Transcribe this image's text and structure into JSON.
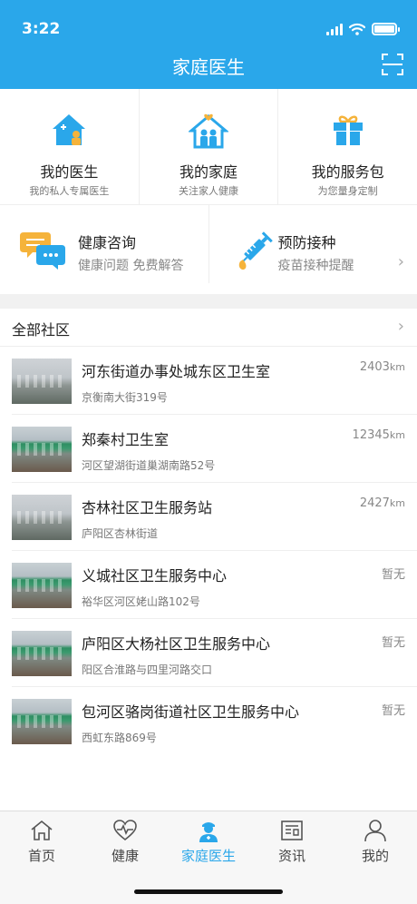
{
  "status_bar": {
    "time": "3:22"
  },
  "header": {
    "title": "家庭医生"
  },
  "features": [
    {
      "title": "我的医生",
      "subtitle": "我的私人专属医生",
      "icon": "doctor-house-icon"
    },
    {
      "title": "我的家庭",
      "subtitle": "关注家人健康",
      "icon": "family-house-icon"
    },
    {
      "title": "我的服务包",
      "subtitle": "为您量身定制",
      "icon": "gift-icon"
    }
  ],
  "services": [
    {
      "title": "健康咨询",
      "subtitle": "健康问题  免费解答",
      "icon": "chat-bubbles-icon"
    },
    {
      "title": "预防接种",
      "subtitle": "疫苗接种提醒",
      "icon": "syringe-icon"
    }
  ],
  "community": {
    "title": "全部社区",
    "items": [
      {
        "name": "河东街道办事处城东区卫生室",
        "address": "京衡南大街319号",
        "distance": "2403",
        "unit": "km",
        "thumb": "gray"
      },
      {
        "name": "郑秦村卫生室",
        "address": "河区望湖街道巢湖南路52号",
        "distance": "12345",
        "unit": "km",
        "thumb": "green"
      },
      {
        "name": "杏林社区卫生服务站",
        "address": "庐阳区杏林街道",
        "distance": "2427",
        "unit": "km",
        "thumb": "gray"
      },
      {
        "name": "义城社区卫生服务中心",
        "address": "裕华区河区姥山路102号",
        "distance": "暂无",
        "unit": "",
        "thumb": "green"
      },
      {
        "name": "庐阳区大杨社区卫生服务中心",
        "address": "阳区合淮路与四里河路交口",
        "distance": "暂无",
        "unit": "",
        "thumb": "green"
      },
      {
        "name": "包河区骆岗街道社区卫生服务中心",
        "address": "西虹东路869号",
        "distance": "暂无",
        "unit": "",
        "thumb": "green"
      }
    ]
  },
  "tabbar": [
    {
      "label": "首页",
      "icon": "home-icon",
      "active": false
    },
    {
      "label": "健康",
      "icon": "heartbeat-icon",
      "active": false
    },
    {
      "label": "家庭医生",
      "icon": "doctor-icon",
      "active": true
    },
    {
      "label": "资讯",
      "icon": "news-icon",
      "active": false
    },
    {
      "label": "我的",
      "icon": "profile-icon",
      "active": false
    }
  ],
  "colors": {
    "primary": "#2aa7ea",
    "accent_orange": "#f5b33b"
  }
}
